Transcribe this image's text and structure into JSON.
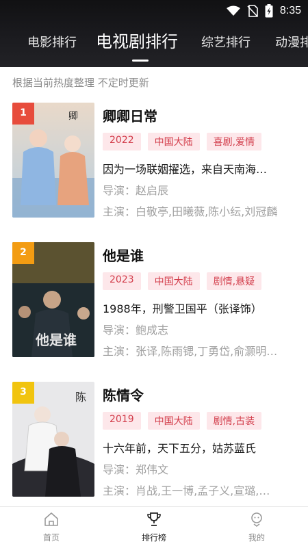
{
  "status_bar": {
    "time": "8:35"
  },
  "tabs": [
    {
      "label": "电影排行"
    },
    {
      "label": "电视剧排行",
      "active": true
    },
    {
      "label": "综艺排行"
    },
    {
      "label": "动漫排行"
    }
  ],
  "subtitle": "根据当前热度整理 不定时更新",
  "items": [
    {
      "rank": "1",
      "title": "卿卿日常",
      "tags": [
        "2022",
        "中国大陆",
        "喜剧,爱情"
      ],
      "desc": "因为一场联姻擢选，来自天南海北的",
      "director": "导演：赵启辰",
      "cast": "主演：白敬亭,田曦薇,陈小纭,刘冠麟"
    },
    {
      "rank": "2",
      "title": "他是谁",
      "tags": [
        "2023",
        "中国大陆",
        "剧情,悬疑"
      ],
      "desc": "1988年，刑警卫国平（张译饰）",
      "director": "导演：鲍成志",
      "cast": "主演：张译,陈雨锶,丁勇岱,俞灏明,杨皓宇"
    },
    {
      "rank": "3",
      "title": "陈情令",
      "tags": [
        "2019",
        "中国大陆",
        "剧情,古装"
      ],
      "desc": "十六年前，天下五分，姑苏蓝氏",
      "director": "导演：郑伟文",
      "cast": "主演：肖战,王一博,孟子义,宣璐,汪卓成"
    }
  ],
  "bottom_nav": [
    {
      "label": "首页",
      "icon": "home-icon"
    },
    {
      "label": "排行榜",
      "icon": "trophy-icon",
      "active": true
    },
    {
      "label": "我的",
      "icon": "profile-icon"
    }
  ]
}
